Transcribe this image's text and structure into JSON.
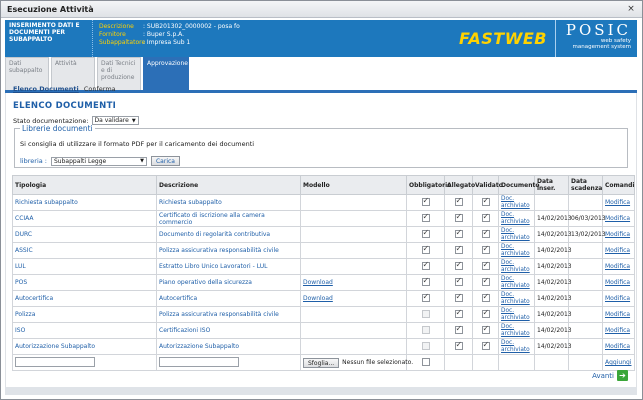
{
  "window": {
    "title": "Esecuzione Attività",
    "close_glyph": "×"
  },
  "banner": {
    "left_text": "INSERIMENTO DATI E DOCUMENTI PER SUBAPPALTO",
    "fields": [
      {
        "label": "Descrizione",
        "value": ": SUB201302_0000002 - posa fo"
      },
      {
        "label": "Fornitore",
        "value": ": Buper S.p.A."
      },
      {
        "label": "Subappaltatore",
        "value": ": Impresa Sub 1"
      }
    ],
    "logo": "FASTWEB",
    "posic": "POSIC",
    "posic_sub1": "web safety",
    "posic_sub2": "management system"
  },
  "tabs": [
    {
      "label": "Dati subappalto"
    },
    {
      "label": "Attività"
    },
    {
      "label": "Dati Tecnici e di produzione"
    },
    {
      "label": "Approvazione"
    }
  ],
  "steps": {
    "active": "Elenco Documenti",
    "next": "Conferma"
  },
  "page_title": "ELENCO DOCUMENTI",
  "stato": {
    "label": "Stato documentazione:",
    "value": "Da validare"
  },
  "librerie": {
    "legend": "Librerie documenti",
    "note": "Si consiglia di utilizzare il formato PDF per il caricamento dei documenti",
    "label": "libreria :",
    "value": "Subappalti Legge",
    "button": "Carica"
  },
  "table": {
    "headers": [
      "Tipologia",
      "Descrizione",
      "Modello",
      "Obbligatorio",
      "Allegato",
      "Validato",
      "Documento",
      "Data inser.",
      "Data scadenza",
      "Comandi"
    ],
    "rows": [
      {
        "tipologia": "Richiesta subappalto",
        "descrizione": "Richiesta subappalto",
        "modello": "",
        "obbl": true,
        "alleg": true,
        "valid": true,
        "doc": "Doc. archiviato",
        "data": "",
        "scad": "",
        "cmd": "Modifica"
      },
      {
        "tipologia": "CCIAA",
        "descrizione": "Certificato di iscrizione alla camera commercio",
        "modello": "",
        "obbl": true,
        "alleg": true,
        "valid": true,
        "doc": "Doc. archiviato",
        "data": "14/02/2013",
        "scad": "06/03/2013",
        "cmd": "Modifica"
      },
      {
        "tipologia": "DURC",
        "descrizione": "Documento di regolarità contributiva",
        "modello": "",
        "obbl": true,
        "alleg": true,
        "valid": true,
        "doc": "Doc. archiviato",
        "data": "14/02/2013",
        "scad": "13/02/2013",
        "cmd": "Modifica"
      },
      {
        "tipologia": "ASSIC",
        "descrizione": "Polizza assicurativa responsabilità civile",
        "modello": "",
        "obbl": true,
        "alleg": true,
        "valid": true,
        "doc": "Doc. archiviato",
        "data": "14/02/2013",
        "scad": "",
        "cmd": "Modifica"
      },
      {
        "tipologia": "LUL",
        "descrizione": "Estratto Libro Unico Lavoratori - LUL",
        "modello": "",
        "obbl": true,
        "alleg": true,
        "valid": true,
        "doc": "Doc. archiviato",
        "data": "14/02/2013",
        "scad": "",
        "cmd": "Modifica"
      },
      {
        "tipologia": "POS",
        "descrizione": "Piano operativo della sicurezza",
        "modello": "Download",
        "obbl": true,
        "alleg": true,
        "valid": true,
        "doc": "Doc. archiviato",
        "data": "14/02/2013",
        "scad": "",
        "cmd": "Modifica"
      },
      {
        "tipologia": "Autocertifica",
        "descrizione": "Autocertifica",
        "modello": "Download",
        "obbl": true,
        "alleg": true,
        "valid": true,
        "doc": "Doc. archiviato",
        "data": "14/02/2013",
        "scad": "",
        "cmd": "Modifica"
      },
      {
        "tipologia": "Polizza",
        "descrizione": "Polizza assicurativa responsabilità civile",
        "modello": "",
        "obbl": false,
        "alleg": true,
        "valid": true,
        "doc": "Doc. archiviato",
        "data": "14/02/2013",
        "scad": "",
        "cmd": "Modifica"
      },
      {
        "tipologia": "ISO",
        "descrizione": "Certificazioni ISO",
        "modello": "",
        "obbl": false,
        "alleg": true,
        "valid": true,
        "doc": "Doc. archiviato",
        "data": "14/02/2013",
        "scad": "",
        "cmd": "Modifica"
      },
      {
        "tipologia": "Autorizzazione Subappalto",
        "descrizione": "Autorizzazione Subappalto",
        "modello": "",
        "obbl": false,
        "alleg": true,
        "valid": true,
        "doc": "Doc. archiviato",
        "data": "14/02/2013",
        "scad": "",
        "cmd": "Modifica"
      }
    ],
    "new_row": {
      "browse": "Sfoglia...",
      "no_file": "Nessun file selezionato.",
      "add": "Aggiungi"
    }
  },
  "avanti": "Avanti"
}
